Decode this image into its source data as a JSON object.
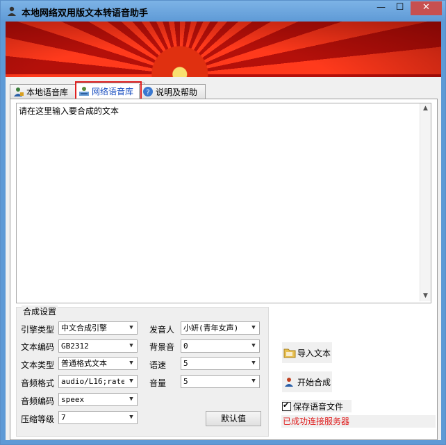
{
  "window": {
    "title": "本地网络双用版文本转语音助手",
    "minimize": "—",
    "maximize": "☐",
    "close": "✕"
  },
  "tabs": [
    {
      "label": "本地语音库",
      "icon": "user-icon"
    },
    {
      "label": "网络语音库",
      "icon": "network-user-icon",
      "active": true
    },
    {
      "label": "说明及帮助",
      "icon": "help-icon"
    }
  ],
  "editor": {
    "text": "请在这里输入要合成的文本"
  },
  "settings": {
    "title": "合成设置",
    "engine_type": {
      "label": "引擎类型",
      "value": "中文合成引擎"
    },
    "text_encoding": {
      "label": "文本编码",
      "value": "GB2312"
    },
    "text_type": {
      "label": "文本类型",
      "value": "普通格式文本"
    },
    "audio_format": {
      "label": "音频格式",
      "value": "audio/L16;rate="
    },
    "audio_encoding": {
      "label": "音频编码",
      "value": "speex"
    },
    "compression": {
      "label": "压缩等级",
      "value": "7"
    },
    "speaker": {
      "label": "发音人",
      "value": "小妍(青年女声)"
    },
    "background": {
      "label": "背景音",
      "value": "0"
    },
    "speed": {
      "label": "语速",
      "value": "5"
    },
    "volume": {
      "label": "音量",
      "value": "5"
    },
    "default_button": "默认值"
  },
  "actions": {
    "import_text": "导入文本",
    "start_synthesis": "开始合成"
  },
  "save_audio": {
    "label": "保存语音文件",
    "checked": true
  },
  "status": "已成功连接服务器",
  "colors": {
    "status_text": "#e02020",
    "active_tab_text": "#1a4fc0",
    "highlight_border": "#e02020",
    "title_bar": "#5e9ad6"
  }
}
